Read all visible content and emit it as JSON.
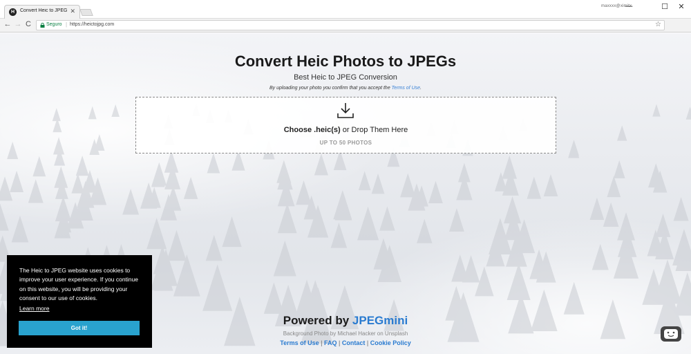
{
  "browser": {
    "tab_title": "Convert Heic to JPEG for",
    "tab_favicon": "H",
    "profile_name": "maxxxx@ximitx",
    "window_minimize": "—",
    "window_maximize": "☐",
    "window_close": "✕",
    "nav_back": "←",
    "nav_forward": "→",
    "nav_reload": "C",
    "secure_label": "Seguro",
    "url_separator": "|",
    "url": "https://heictojpg.com"
  },
  "hero": {
    "title": "Convert Heic Photos to JPEGs",
    "subtitle": "Best Heic to JPEG Conversion",
    "terms_prefix": "By uploading your photo you confirm that you accept the ",
    "terms_link": "Terms of Use",
    "terms_suffix": "."
  },
  "dropzone": {
    "choose_label": "Choose .heic(s)",
    "drop_label": " or Drop Them Here",
    "limit_label": "UP TO 50 PHOTOS"
  },
  "footer": {
    "powered_prefix": "Powered by ",
    "powered_brand": "JPEGmini",
    "credit": "Background Photo by Michael Hacker on Unsplash",
    "links": [
      "Terms of Use",
      "FAQ",
      "Contact",
      "Cookie Policy"
    ],
    "separator": "|"
  },
  "cookie_banner": {
    "message": "The Heic to JPEG website uses cookies to improve your user experience. If you continue on this website, you will be providing your consent to our use of cookies.",
    "learn_more": "Learn more",
    "accept_button": "Got it!"
  },
  "colors": {
    "link_blue": "#2a7bd0",
    "cookie_button": "#29a2ce",
    "secure_green": "#0b8043"
  },
  "icons": {
    "tab_close": "✕",
    "star": "☆",
    "extension": "◈",
    "menu": "⋮"
  }
}
